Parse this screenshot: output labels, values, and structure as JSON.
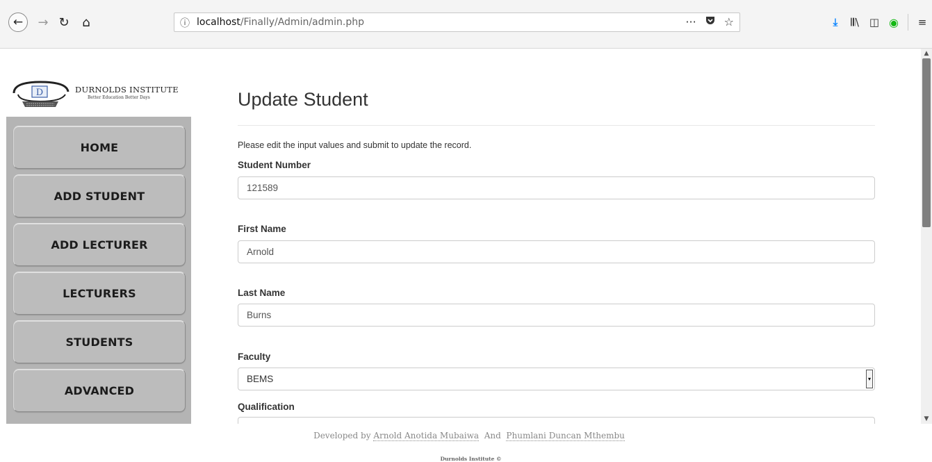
{
  "browser": {
    "url_host": "localhost",
    "url_path": "/Finally/Admin/admin.php",
    "page_actions_icon": "···"
  },
  "sidebar": {
    "logo_name": "DURNOLDS INSTITUTE",
    "logo_tagline": "Better Education Better Days",
    "logo_letter": "D",
    "items": [
      {
        "label": "HOME"
      },
      {
        "label": "ADD STUDENT"
      },
      {
        "label": "ADD LECTURER"
      },
      {
        "label": "LECTURERS"
      },
      {
        "label": "STUDENTS"
      },
      {
        "label": "ADVANCED"
      }
    ]
  },
  "form": {
    "title": "Update Student",
    "intro": "Please edit the input values and submit to update the record.",
    "student_number": {
      "label": "Student Number",
      "value": "121589"
    },
    "first_name": {
      "label": "First Name",
      "value": "Arnold"
    },
    "last_name": {
      "label": "Last Name",
      "value": "Burns"
    },
    "faculty": {
      "label": "Faculty",
      "value": "BEMS"
    },
    "qualification": {
      "label": "Qualification",
      "value": ""
    }
  },
  "footer": {
    "developed_by": "Developed by",
    "dev1": "Arnold Anotida Mubaiwa",
    "and": "And",
    "dev2": "Phumlani Duncan Mthembu",
    "copyright": "Durnolds Institute ©"
  }
}
